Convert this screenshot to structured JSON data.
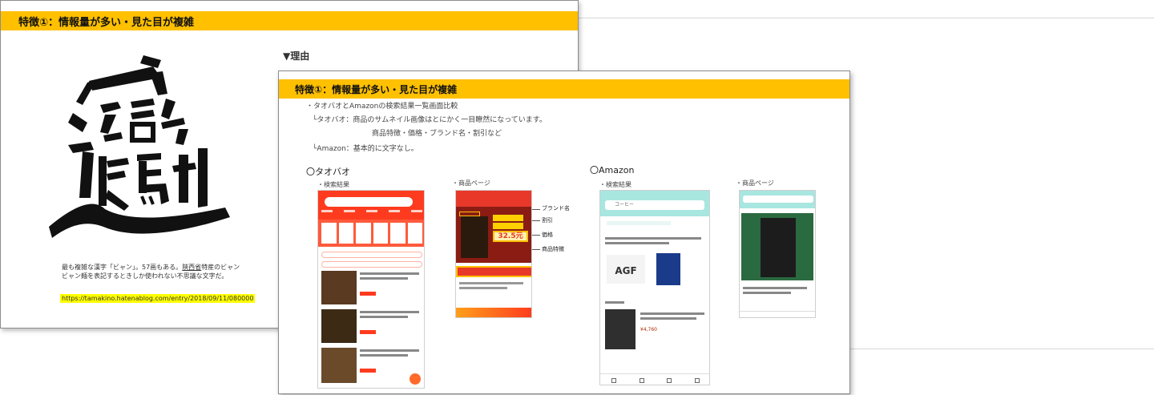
{
  "slide1": {
    "title": "特徴①：情報量が多い・見た目が複雑",
    "kanji": "𰻞",
    "caption_part1": "最も複雑な漢字「ビャン」。57画もある。",
    "caption_link": "陝西省",
    "caption_part2": "特産のビャンビャン麺を表記するときしか使われない不思議な文字だ。",
    "url": "https://tamakino.hatenablog.com/entry/2018/09/11/080000",
    "reason_heading": "▼理由"
  },
  "slide2": {
    "title": "特徴①：情報量が多い・見た目が複雑",
    "line1": "・タオバオとAmazonの検索結果一覧画面比較",
    "line2": "└タオバオ：商品のサムネイル画像はとにかく一目瞭然になっています。",
    "line3": "商品特徴・価格・ブランド名・割引など",
    "line4": "└Amazon：基本的に文字なし。",
    "taobao_heading": "〇タオバオ",
    "amazon_heading": "〇Amazon",
    "search_results_label": "・検索結果",
    "product_page_label": "・商品ページ",
    "amazon_search_label": "・検索結果",
    "amazon_product_label": "・商品ページ",
    "annotations": [
      "ブランド名",
      "割引",
      "価格",
      "商品特徴"
    ],
    "price_tag": "32.5元",
    "amazon_search_query": "コーヒー",
    "amazon_brand": "AGF",
    "amazon_price": "¥4,760"
  },
  "colors": {
    "banner": "#ffc000",
    "taobao": "#ff3b1f",
    "amazon_bar": "#a8e6e0"
  }
}
